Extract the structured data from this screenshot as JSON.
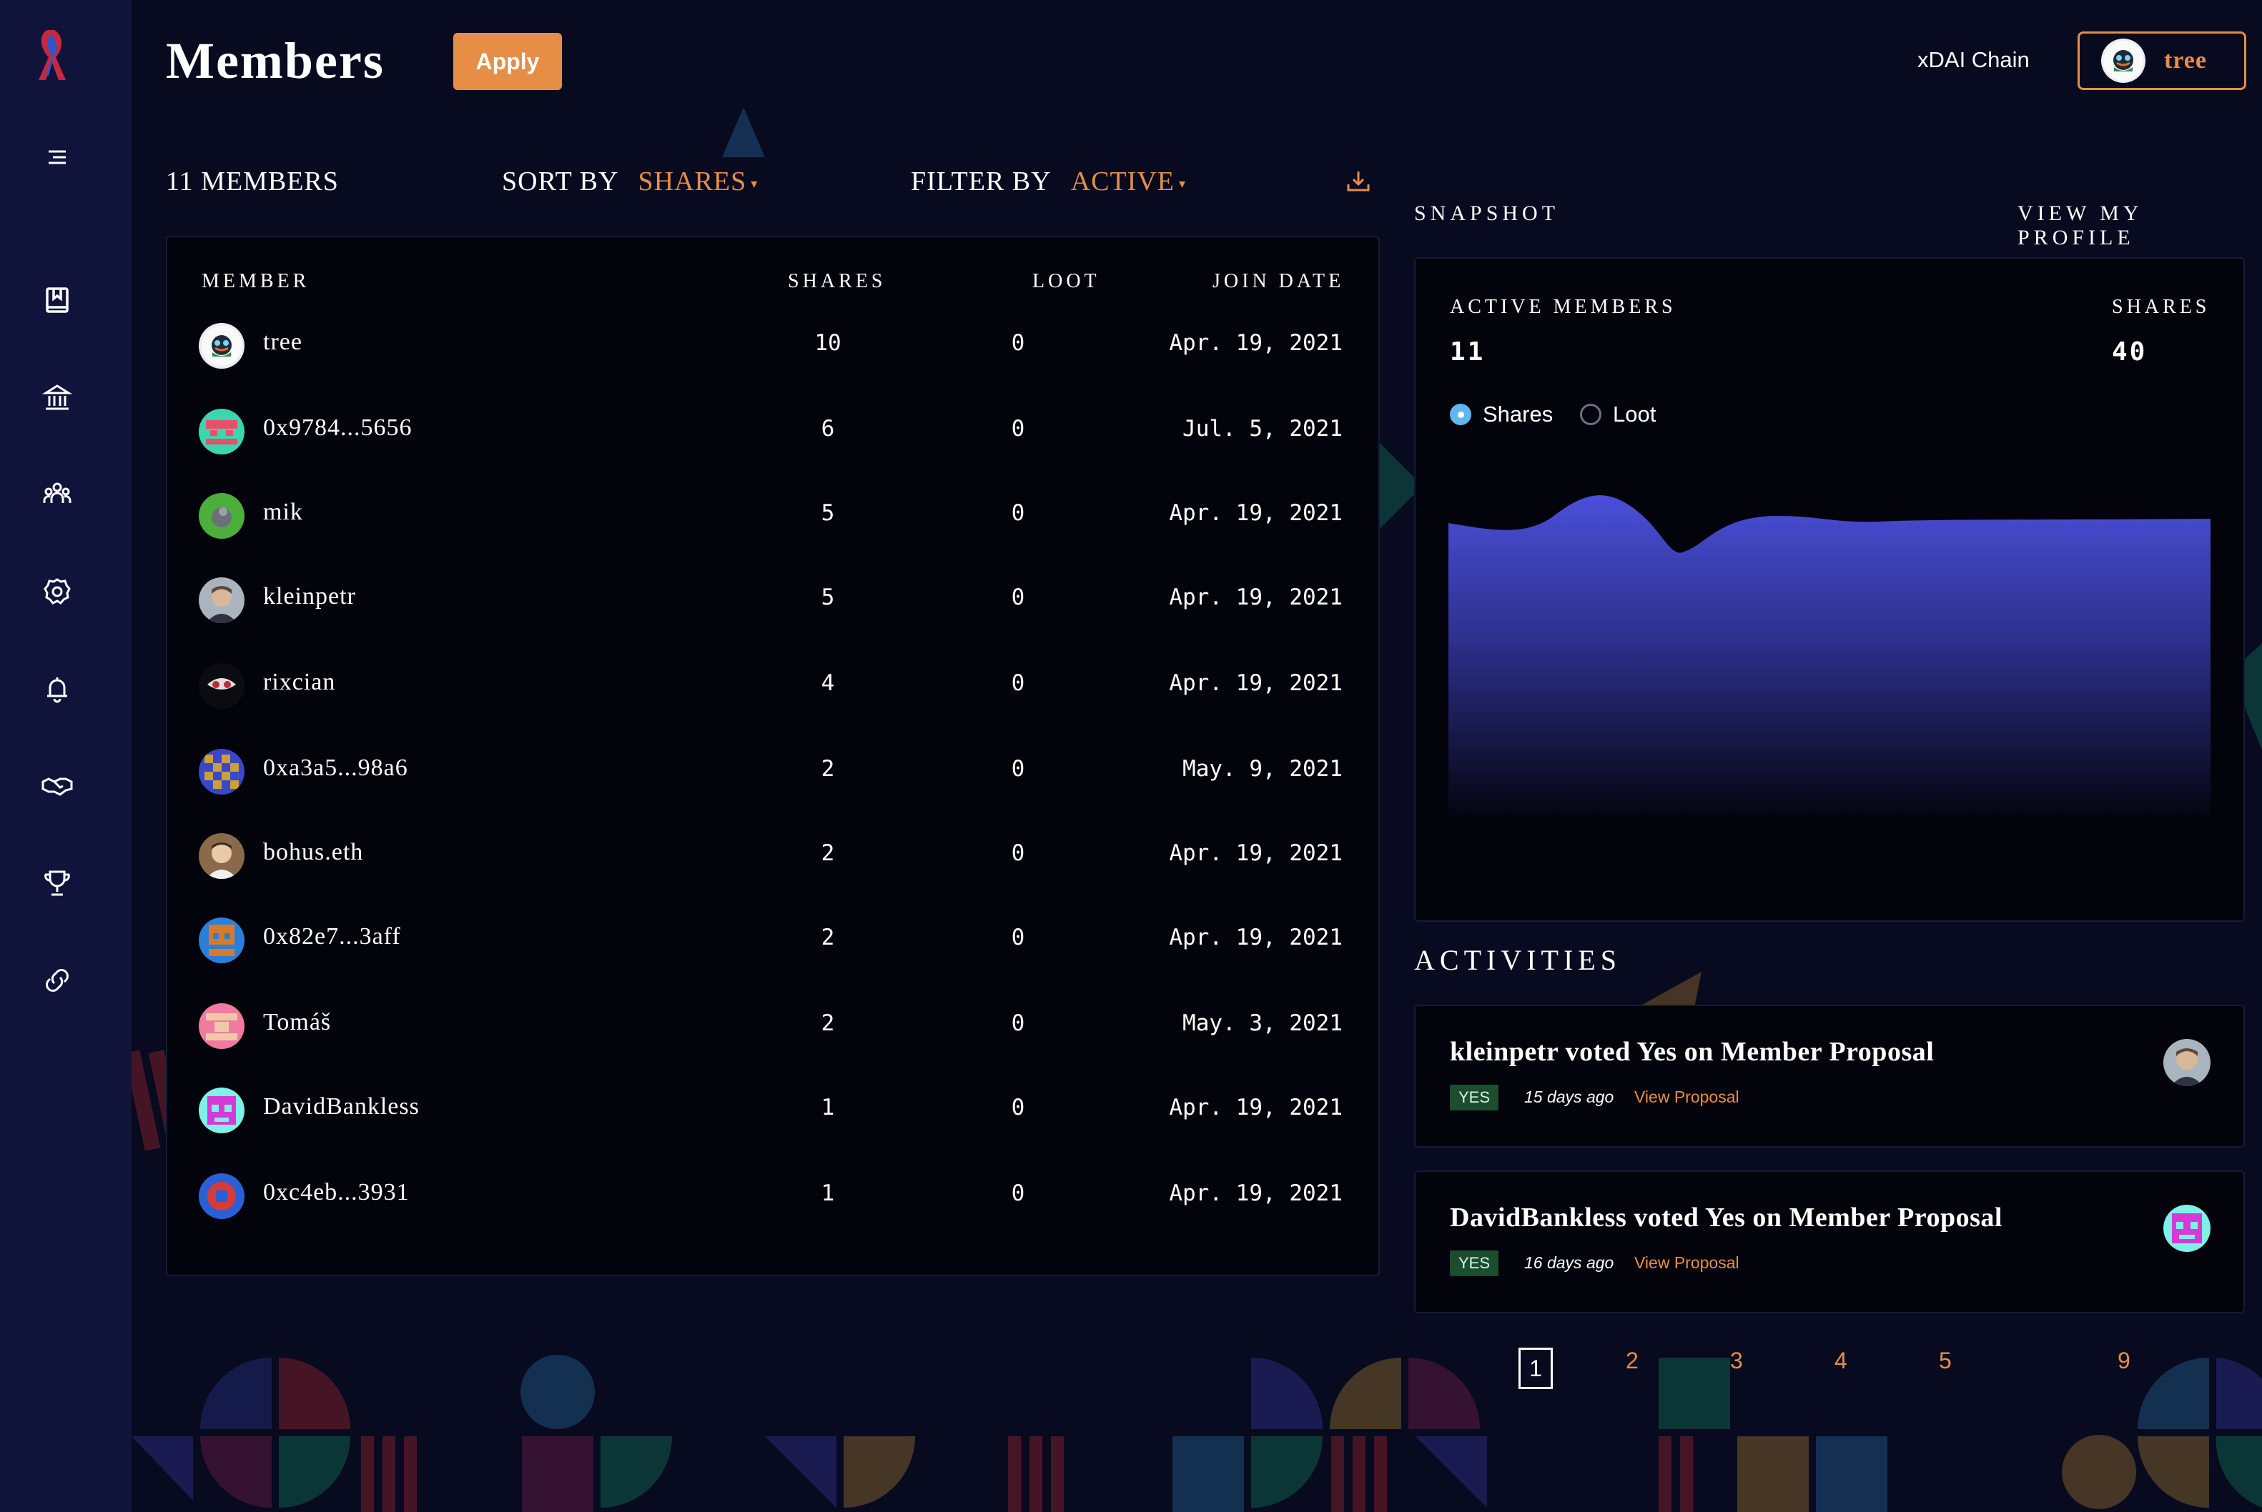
{
  "header": {
    "title": "Members",
    "apply_label": "Apply",
    "chain": "xDAI Chain",
    "user_name": "tree"
  },
  "toolbar": {
    "member_count": "11 MEMBERS",
    "sort_label": "SORT BY",
    "sort_value": "SHARES",
    "filter_label": "FILTER BY",
    "filter_value": "ACTIVE"
  },
  "table": {
    "columns": [
      "MEMBER",
      "SHARES",
      "LOOT",
      "JOIN DATE"
    ],
    "rows": [
      {
        "name": "tree",
        "shares": "10",
        "loot": "0",
        "date": "Apr. 19, 2021",
        "avatar": "avatar-tree"
      },
      {
        "name": "0x9784...5656",
        "shares": "6",
        "loot": "0",
        "date": "Jul. 5, 2021",
        "avatar": "avatar-pixel-teal"
      },
      {
        "name": "mik",
        "shares": "5",
        "loot": "0",
        "date": "Apr. 19, 2021",
        "avatar": "avatar-mik"
      },
      {
        "name": "kleinpetr",
        "shares": "5",
        "loot": "0",
        "date": "Apr. 19, 2021",
        "avatar": "avatar-photo"
      },
      {
        "name": "rixcian",
        "shares": "4",
        "loot": "0",
        "date": "Apr. 19, 2021",
        "avatar": "avatar-rixcian"
      },
      {
        "name": "0xa3a5...98a6",
        "shares": "2",
        "loot": "0",
        "date": "May. 9, 2021",
        "avatar": "avatar-pixel-blue"
      },
      {
        "name": "bohus.eth",
        "shares": "2",
        "loot": "0",
        "date": "Apr. 19, 2021",
        "avatar": "avatar-photo-2"
      },
      {
        "name": "0x82e7...3aff",
        "shares": "2",
        "loot": "0",
        "date": "Apr. 19, 2021",
        "avatar": "avatar-pixel-orange"
      },
      {
        "name": "Tomáš",
        "shares": "2",
        "loot": "0",
        "date": "May. 3, 2021",
        "avatar": "avatar-pixel-pink"
      },
      {
        "name": "DavidBankless",
        "shares": "1",
        "loot": "0",
        "date": "Apr. 19, 2021",
        "avatar": "avatar-pixel-magenta"
      },
      {
        "name": "0xc4eb...3931",
        "shares": "1",
        "loot": "0",
        "date": "Apr. 19, 2021",
        "avatar": "avatar-pixel-red"
      }
    ]
  },
  "snapshot": {
    "label": "SNAPSHOT",
    "profile_link": "VIEW MY PROFILE",
    "active_members_label": "ACTIVE MEMBERS",
    "active_members_value": "11",
    "shares_label": "SHARES",
    "shares_value": "40",
    "radio_shares": "Shares",
    "radio_loot": "Loot",
    "selected": "Shares",
    "chart_color": "#4a4fd8"
  },
  "activities": {
    "title": "ACTIVITIES",
    "items": [
      {
        "text": "kleinpetr voted Yes on Member Proposal",
        "badge": "YES",
        "ago": "15 days ago",
        "link": "View Proposal"
      },
      {
        "text": "DavidBankless voted Yes on Member Proposal",
        "badge": "YES",
        "ago": "16 days ago",
        "link": "View Proposal"
      }
    ]
  },
  "pagination": {
    "pages": [
      "1",
      "2",
      "3",
      "4",
      "5",
      "9"
    ],
    "current": "1"
  },
  "colors": {
    "accent": "#e78e46",
    "background": "#080a1f",
    "sidebar": "#10143a",
    "card": "#03030b"
  },
  "icons": [
    "menu-icon",
    "book-icon",
    "bank-icon",
    "members-icon",
    "settings-icon",
    "bell-icon",
    "handshake-icon",
    "trophy-icon",
    "link-icon",
    "download-icon"
  ]
}
